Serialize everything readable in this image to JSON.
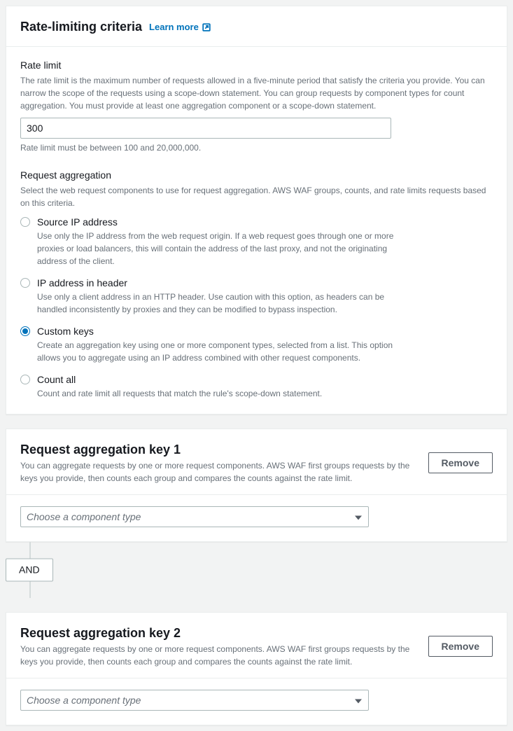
{
  "criteria": {
    "title": "Rate-limiting criteria",
    "learn_more": "Learn more",
    "rate_limit": {
      "label": "Rate limit",
      "desc": "The rate limit is the maximum number of requests allowed in a five-minute period that satisfy the criteria you provide. You can narrow the scope of the requests using a scope-down statement. You can group requests by component types for count aggregation. You must provide at least one aggregation component or a scope-down statement.",
      "value": "300",
      "hint": "Rate limit must be between 100 and 20,000,000."
    },
    "aggregation": {
      "label": "Request aggregation",
      "desc": "Select the web request components to use for request aggregation. AWS WAF groups, counts, and rate limits requests based on this criteria.",
      "options": [
        {
          "name": "source-ip",
          "label": "Source IP address",
          "desc": "Use only the IP address from the web request origin. If a web request goes through one or more proxies or load balancers, this will contain the address of the last proxy, and not the originating address of the client.",
          "selected": false
        },
        {
          "name": "ip-header",
          "label": "IP address in header",
          "desc": "Use only a client address in an HTTP header. Use caution with this option, as headers can be handled inconsistently by proxies and they can be modified to bypass inspection.",
          "selected": false
        },
        {
          "name": "custom-keys",
          "label": "Custom keys",
          "desc": "Create an aggregation key using one or more component types, selected from a list. This option allows you to aggregate using an IP address combined with other request components.",
          "selected": true
        },
        {
          "name": "count-all",
          "label": "Count all",
          "desc": "Count and rate limit all requests that match the rule's scope-down statement.",
          "selected": false
        }
      ]
    }
  },
  "keys": [
    {
      "title": "Request aggregation key 1",
      "desc": "You can aggregate requests by one or more request components. AWS WAF first groups requests by the keys you provide, then counts each group and compares the counts against the rate limit.",
      "remove_label": "Remove",
      "placeholder": "Choose a component type"
    },
    {
      "title": "Request aggregation key 2",
      "desc": "You can aggregate requests by one or more request components. AWS WAF first groups requests by the keys you provide, then counts each group and compares the counts against the rate limit.",
      "remove_label": "Remove",
      "placeholder": "Choose a component type"
    }
  ],
  "connector": {
    "label": "AND"
  }
}
